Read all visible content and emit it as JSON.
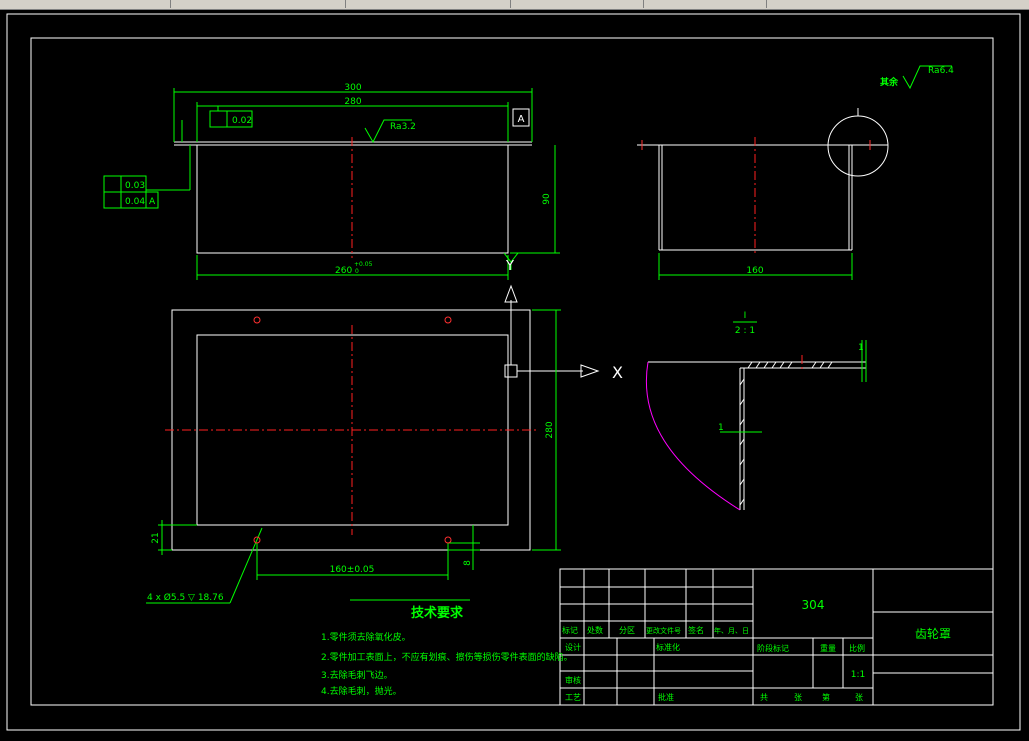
{
  "drawing": {
    "title": "齿轮罩",
    "material": "304",
    "scale": "1:1",
    "surface_finish_other": "其余",
    "ra_other": "Ra6.4",
    "ra_top": "Ra3.2",
    "datum_a": "A",
    "tolerances": {
      "flatness_top": "0.02",
      "flatness_side": "0.03",
      "parallel_side": "0.04",
      "parallel_ref": "A"
    },
    "dimensions": {
      "top_overall": "300",
      "top_inner": "280",
      "height": "90",
      "bottom_width": "260",
      "bottom_tol": "+0.05",
      "bottom_tol_low": "0",
      "side_width": "160",
      "plan_height": "280",
      "plan_hole_pitch": "160±0.05",
      "hole_spec": "4 x Ø5.5 ▽ 18.76",
      "edge_21": "21",
      "edge_8": "8",
      "detail_1a": "1",
      "detail_1b": "1"
    },
    "detail": {
      "label": "I",
      "scale": "2 : 1"
    },
    "view_markers": {
      "x": "X",
      "y": "Y"
    },
    "tech_requirements": {
      "heading": "技术要求",
      "items": [
        "1.零件须去除氧化皮。",
        "2.零件加工表面上，不应有划痕、擦伤等损伤零件表面的缺陷。",
        "3.去除毛刺飞边。",
        "4.去除毛刺，抛光。"
      ]
    },
    "title_block": {
      "mark": "标记",
      "count": "处数",
      "zone": "分区",
      "change_doc": "更改文件号",
      "signature": "签名",
      "date": "年、月、日",
      "design": "设计",
      "standardize": "标准化",
      "review": "审核",
      "process": "工艺",
      "approve": "批准",
      "stage_mark": "阶段标记",
      "weight": "重量",
      "scale_label": "比例",
      "total": "共",
      "sheets": "张",
      "sheet_no": "第",
      "sheet_unit": "张"
    }
  }
}
